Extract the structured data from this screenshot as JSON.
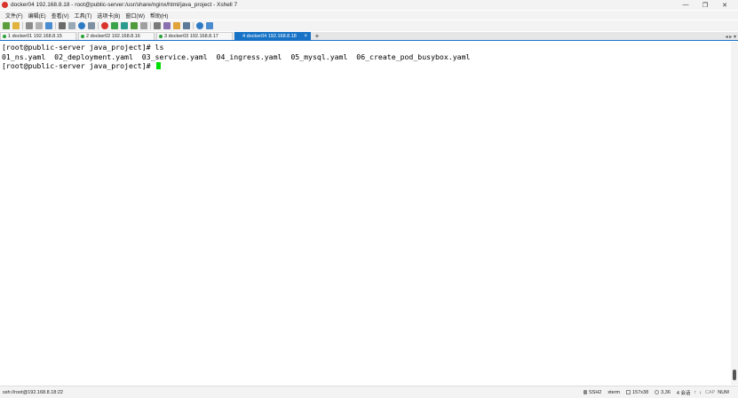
{
  "window": {
    "title": "docker04 192.168.8.18 - root@public-server:/usr/share/nginx/html/java_project - Xshell 7",
    "minimize": "—",
    "maximize": "❐",
    "close": "✕"
  },
  "menu": [
    "文件(F)",
    "编辑(E)",
    "查看(V)",
    "工具(T)",
    "选项卡(B)",
    "窗口(W)",
    "帮助(H)"
  ],
  "toolbar": {
    "icons": [
      "new-session-icon",
      "open-folder-icon",
      "link-icon",
      "unlink-icon",
      "reconnect-icon",
      "search-icon",
      "copy-icon",
      "globe-icon",
      "font-icon",
      "color-icon",
      "transfer-icon",
      "terminal-icon",
      "fullscreen-icon",
      "lock-icon",
      "keyboard-icon",
      "script-icon",
      "folder-icon",
      "layout-icon",
      "help-icon",
      "chat-icon"
    ]
  },
  "tabs": [
    {
      "label": "1 docker01 192.168.8.15",
      "active": false
    },
    {
      "label": "2 docker02 192.168.8.16",
      "active": false
    },
    {
      "label": "3 docker03 192.168.8.17",
      "active": false
    },
    {
      "label": "4 docker04 192.168.8.18",
      "active": true
    }
  ],
  "tab_add": "+",
  "tab_nav": "◂ ▸ ▾",
  "terminal": {
    "lines": [
      "[root@public-server java_project]# ls",
      "01_ns.yaml  02_deployment.yaml  03_service.yaml  04_ingress.yaml  05_mysql.yaml  06_create_pod_busybox.yaml",
      "[root@public-server java_project]# "
    ]
  },
  "status": {
    "connection": "ssh://root@192.168.8.18:22",
    "protocol": "SSH2",
    "terminal_type": "xterm",
    "size": "157x38",
    "cursor_pos": "3,36",
    "sessions": "4 会话",
    "caps": "CAP",
    "num": "NUM"
  },
  "colors": {
    "accent": "#1873c7",
    "cursor": "#00e000",
    "connected": "#2aa33b"
  }
}
